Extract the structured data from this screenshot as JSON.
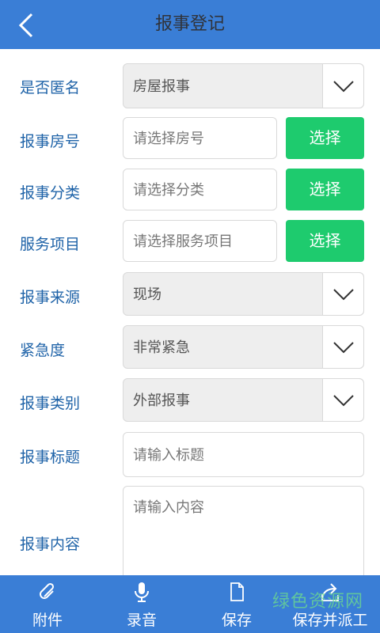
{
  "header": {
    "title": "报事登记",
    "back_icon": "chevron-left-icon"
  },
  "form": {
    "anonymous": {
      "label": "是否匿名",
      "value": "房屋报事"
    },
    "room": {
      "label": "报事房号",
      "placeholder": "请选择房号",
      "button": "选择"
    },
    "category": {
      "label": "报事分类",
      "placeholder": "请选择分类",
      "button": "选择"
    },
    "service": {
      "label": "服务项目",
      "placeholder": "请选择服务项目",
      "button": "选择"
    },
    "source": {
      "label": "报事来源",
      "value": "现场"
    },
    "urgency": {
      "label": "紧急度",
      "value": "非常紧急"
    },
    "type": {
      "label": "报事类别",
      "value": "外部报事"
    },
    "title": {
      "label": "报事标题",
      "placeholder": "请输入标题"
    },
    "content": {
      "label": "报事内容",
      "placeholder": "请输入内容"
    }
  },
  "bottom_bar": {
    "attach": {
      "label": "附件",
      "icon": "paperclip-icon"
    },
    "record": {
      "label": "录音",
      "icon": "microphone-icon"
    },
    "save": {
      "label": "保存",
      "icon": "document-icon"
    },
    "save_dispatch": {
      "label": "保存并派工",
      "icon": "share-arrow-icon"
    }
  },
  "watermark": "绿色资源网",
  "colors": {
    "header_bg": "#3a7ed6",
    "label_text": "#1f63a8",
    "button_green": "#1ecb6e"
  }
}
